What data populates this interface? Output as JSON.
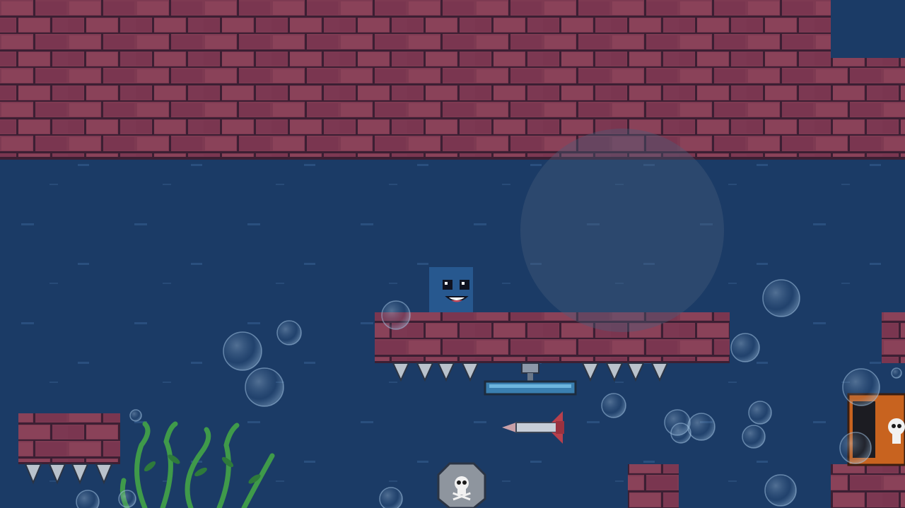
{
  "scene": {
    "type": "underwater-platformer-level",
    "colors": {
      "water": "#1b3b66",
      "water_streak": "#2d5382",
      "brick_fill": "#7e3a52",
      "brick_light": "#8e4560",
      "brick_mortar": "#3c1f33",
      "spike": "#b9c2cc",
      "player": "#27588f",
      "seaweed": "#3f9a4a",
      "bubble": "#7fa6c8",
      "overlay_orb": "#4a5e7c"
    }
  },
  "player": {
    "name": "blue-cube-character",
    "expression": "smiling"
  },
  "hazards": [
    {
      "name": "spike-row",
      "count": 4
    },
    {
      "name": "spike-row",
      "count": 4
    },
    {
      "name": "spike-row",
      "count": 4
    },
    {
      "name": "rocket-missile"
    },
    {
      "name": "skull-sign"
    },
    {
      "name": "skull-crate"
    }
  ],
  "props": [
    {
      "name": "spring-trampoline"
    },
    {
      "name": "seaweed-plant"
    },
    {
      "name": "bubbles"
    }
  ],
  "touch_controls": {
    "joystick": "translucent-orb"
  }
}
